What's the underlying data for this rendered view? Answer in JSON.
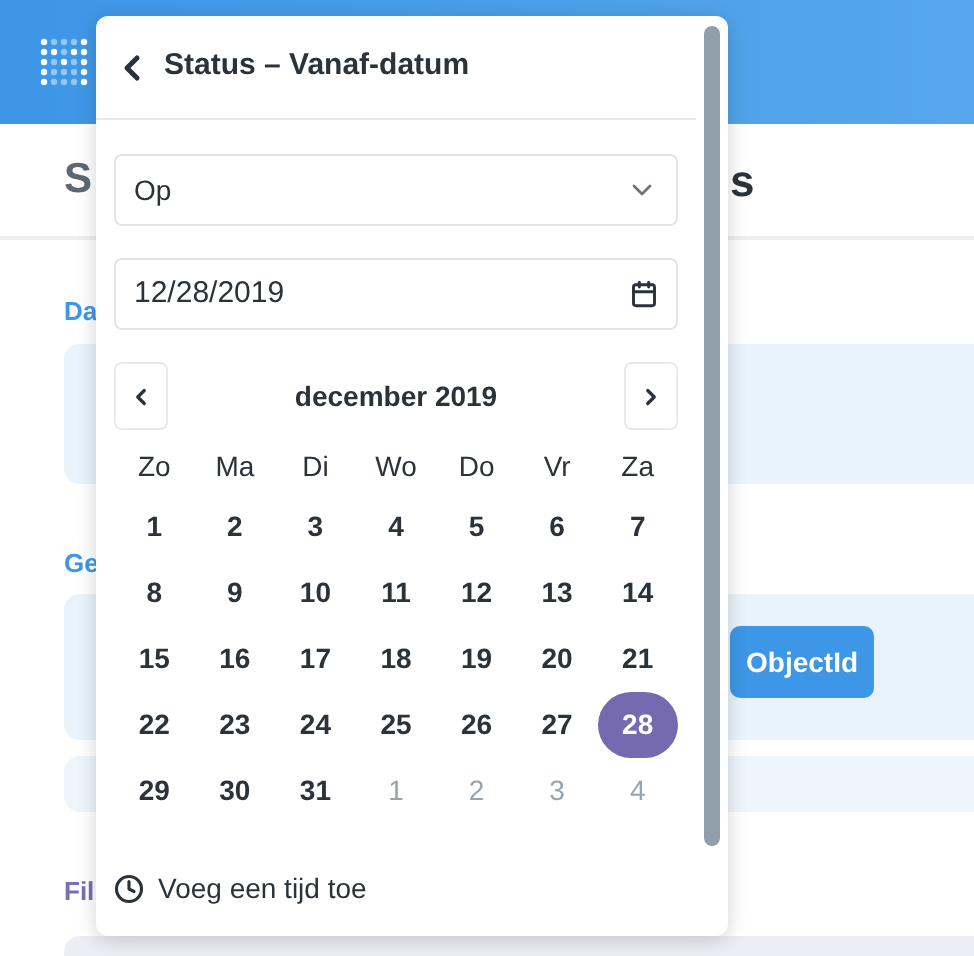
{
  "page": {
    "heading_start": "S",
    "heading_end": "s",
    "sections": [
      {
        "label": "Da",
        "kind": "info"
      },
      {
        "label": "Ge",
        "kind": "info"
      },
      {
        "label": "Fil",
        "kind": "filter"
      }
    ],
    "object_button": "ObjectId"
  },
  "popover": {
    "title": "Status – Vanaf-datum",
    "operator": "Op",
    "date_value": "12/28/2019",
    "calendar": {
      "month": "december 2019",
      "weekdays": [
        "Zo",
        "Ma",
        "Di",
        "Wo",
        "Do",
        "Vr",
        "Za"
      ],
      "weeks": [
        [
          {
            "label": "1",
            "selected": false,
            "outside": false
          },
          {
            "label": "2",
            "selected": false,
            "outside": false
          },
          {
            "label": "3",
            "selected": false,
            "outside": false
          },
          {
            "label": "4",
            "selected": false,
            "outside": false
          },
          {
            "label": "5",
            "selected": false,
            "outside": false
          },
          {
            "label": "6",
            "selected": false,
            "outside": false
          },
          {
            "label": "7",
            "selected": false,
            "outside": false
          }
        ],
        [
          {
            "label": "8",
            "selected": false,
            "outside": false
          },
          {
            "label": "9",
            "selected": false,
            "outside": false
          },
          {
            "label": "10",
            "selected": false,
            "outside": false
          },
          {
            "label": "11",
            "selected": false,
            "outside": false
          },
          {
            "label": "12",
            "selected": false,
            "outside": false
          },
          {
            "label": "13",
            "selected": false,
            "outside": false
          },
          {
            "label": "14",
            "selected": false,
            "outside": false
          }
        ],
        [
          {
            "label": "15",
            "selected": false,
            "outside": false
          },
          {
            "label": "16",
            "selected": false,
            "outside": false
          },
          {
            "label": "17",
            "selected": false,
            "outside": false
          },
          {
            "label": "18",
            "selected": false,
            "outside": false
          },
          {
            "label": "19",
            "selected": false,
            "outside": false
          },
          {
            "label": "20",
            "selected": false,
            "outside": false
          },
          {
            "label": "21",
            "selected": false,
            "outside": false
          }
        ],
        [
          {
            "label": "22",
            "selected": false,
            "outside": false
          },
          {
            "label": "23",
            "selected": false,
            "outside": false
          },
          {
            "label": "24",
            "selected": false,
            "outside": false
          },
          {
            "label": "25",
            "selected": false,
            "outside": false
          },
          {
            "label": "26",
            "selected": false,
            "outside": false
          },
          {
            "label": "27",
            "selected": false,
            "outside": false
          },
          {
            "label": "28",
            "selected": true,
            "outside": false
          }
        ],
        [
          {
            "label": "29",
            "selected": false,
            "outside": false
          },
          {
            "label": "30",
            "selected": false,
            "outside": false
          },
          {
            "label": "31",
            "selected": false,
            "outside": false
          },
          {
            "label": "1",
            "selected": false,
            "outside": true
          },
          {
            "label": "2",
            "selected": false,
            "outside": true
          },
          {
            "label": "3",
            "selected": false,
            "outside": true
          },
          {
            "label": "4",
            "selected": false,
            "outside": true
          }
        ]
      ]
    },
    "add_time": "Voeg een tijd toe"
  }
}
